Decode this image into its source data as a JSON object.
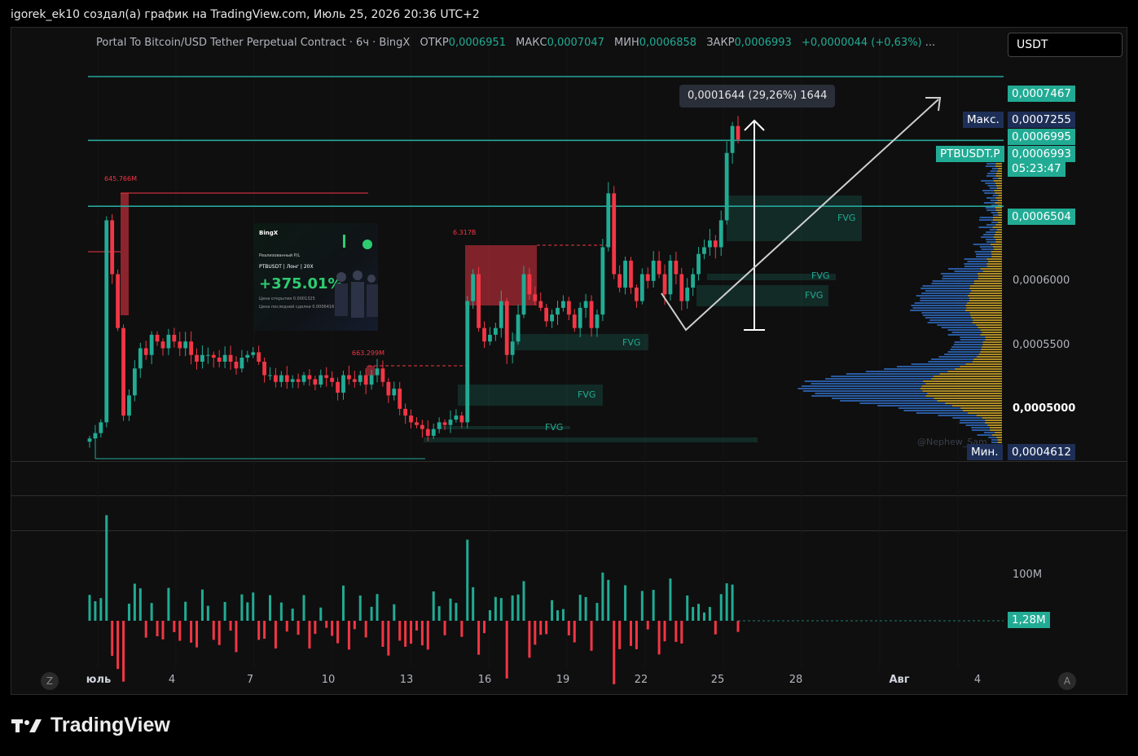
{
  "caption": "igorek_ek10 создал(а) график на TradingView.com, Июль 25, 2026 20:36 UTC+2",
  "legend": {
    "symbol": "Portal To Bitcoin/USD Tether Perpetual Contract · 6ч · BingX",
    "open_label": "ОТКР",
    "open": "0,0006951",
    "high_label": "МАКС",
    "high": "0,0007047",
    "low_label": "МИН",
    "low": "0,0006858",
    "close_label": "ЗАКР",
    "close": "0,0006993",
    "change": "+0,0000044 (+0,63%)",
    "more": "..."
  },
  "currency": "USDT",
  "price_tags": {
    "top": "0,0007467",
    "max_label": "Макс.",
    "max": "0,0007255",
    "p1": "0,0006995",
    "symbol": "PTBUSDT.P",
    "last": "0,0006993",
    "timer": "05:23:47",
    "p2": "0,0006504",
    "min_label": "Мин.",
    "min": "0,0004612",
    "volume": "1,28M"
  },
  "price_axis": [
    "0,0006000",
    "0,0005500",
    "0,0005000"
  ],
  "volume_axis": "100M",
  "measure": "0,0001644 (29,26%) 1644",
  "notes": [
    "645.766M",
    "6.317B",
    "663.299M"
  ],
  "fvg_label": "FVG",
  "promo": {
    "brand": "BingX",
    "subtitle": "Реализованный P/L",
    "pair": "PTBUSDT  |  Лонг  |  20X",
    "pnl": "+375.01%",
    "entry": "Цена открытия   0.0001325",
    "last": "Цена последней сделки   0.0006416"
  },
  "watermark": "@Nephew_Sam_",
  "axis_buttons": [
    "Z",
    "A"
  ],
  "date_axis": [
    {
      "label": "юль",
      "bold": true
    },
    {
      "label": "4"
    },
    {
      "label": "7"
    },
    {
      "label": "10"
    },
    {
      "label": "13"
    },
    {
      "label": "16"
    },
    {
      "label": "19"
    },
    {
      "label": "22"
    },
    {
      "label": "25"
    },
    {
      "label": "28"
    },
    {
      "label": "Авг",
      "bold": true
    },
    {
      "label": "4"
    }
  ],
  "brand": "TradingView",
  "colors": {
    "up": "#22ab94",
    "down": "#f23645",
    "line": "#26a69a",
    "background": "#0f0f0f"
  },
  "chart_data": {
    "type": "candlestick",
    "interval": "6h",
    "ylim": [
      0.00046,
      0.00076
    ],
    "horizontal_levels": [
      0.0007467,
      0.0006993,
      0.0006504
    ],
    "closes": [
      0.000478,
      0.000482,
      0.00049,
      0.00064,
      0.0006,
      0.00056,
      0.000495,
      0.00051,
      0.00053,
      0.000545,
      0.00054,
      0.000555,
      0.00055,
      0.000545,
      0.000555,
      0.00055,
      0.000545,
      0.00055,
      0.00054,
      0.000535,
      0.00054,
      0.00054,
      0.000538,
      0.000535,
      0.00054,
      0.000535,
      0.00053,
      0.000538,
      0.00054,
      0.000542,
      0.000535,
      0.000525,
      0.000525,
      0.00052,
      0.000525,
      0.00052,
      0.000522,
      0.00052,
      0.000525,
      0.000522,
      0.000518,
      0.000525,
      0.000523,
      0.00052,
      0.000512,
      0.000525,
      0.000522,
      0.00052,
      0.000525,
      0.000518,
      0.000525,
      0.00053,
      0.00052,
      0.00051,
      0.000515,
      0.0005,
      0.000495,
      0.00049,
      0.000488,
      0.000485,
      0.00048,
      0.000485,
      0.00049,
      0.000488,
      0.000492,
      0.000495,
      0.00049,
      0.00058,
      0.0006,
      0.00056,
      0.00055,
      0.000555,
      0.00056,
      0.00058,
      0.00054,
      0.00055,
      0.00057,
      0.0006,
      0.000585,
      0.00058,
      0.000575,
      0.000565,
      0.00057,
      0.000575,
      0.00058,
      0.00057,
      0.00056,
      0.000575,
      0.00058,
      0.00056,
      0.00057,
      0.00062,
      0.00066,
      0.0006,
      0.00059,
      0.00061,
      0.00059,
      0.00058,
      0.0006,
      0.000595,
      0.00061,
      0.0006,
      0.000585,
      0.00061,
      0.0006,
      0.00058,
      0.00059,
      0.0006,
      0.000615,
      0.00062,
      0.000625,
      0.00062,
      0.00064,
      0.00069,
      0.00071,
      0.0007
    ],
    "volume_max_label": "100M",
    "last_volume": "1,28M"
  }
}
